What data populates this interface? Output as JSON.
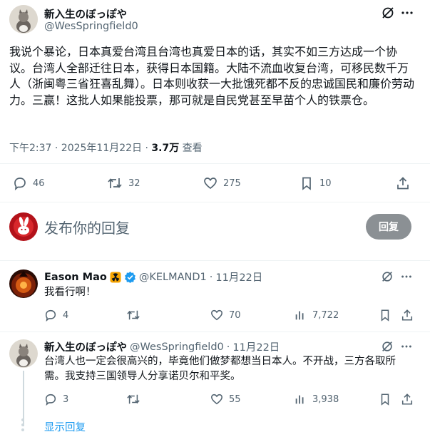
{
  "main_tweet": {
    "author_name": "新入生のぼっぽや",
    "handle": "@WesSpringfield0",
    "text": "我说个暴论，日本真爱台湾且台湾也真爱日本的话，其实不如三方达成一个协议。台湾人全部迁往日本，获得日本国籍。大陆不流血收复台湾，可移民数千万人（浙闽粤三省狂喜乱舞）。日本则收获一大批饿死都不反的忠诚国民和廉价劳动力。三赢！这批人如果能投票，那可就是自民党甚至早苗个人的铁票仓。",
    "timestamp": "下午2:37 · 2025年11月22日 · ",
    "views_value": "3.7万",
    "views_label": " 查看",
    "replies": "46",
    "retweets": "32",
    "likes": "275",
    "bookmarks": "10"
  },
  "compose": {
    "placeholder": "发布你的回复",
    "button_label": "回复"
  },
  "replies": [
    {
      "author_name": "Eason Mao",
      "handle": "@KELMAND1",
      "date": "11月22日",
      "text": "我看行啊！",
      "replies": "4",
      "retweets": "",
      "likes": "70",
      "views": "7,722",
      "verified": true
    },
    {
      "author_name": "新入生のぼっぽや",
      "handle": "@WesSpringfield0",
      "date": "11月22日",
      "text": "台湾人也一定会很高兴的，毕竟他们做梦都想当日本人。不开战，三方各取所需。我支持三国领导人分享诺贝尔和平奖。",
      "replies": "3",
      "retweets": "",
      "likes": "55",
      "views": "3,938"
    }
  ],
  "show_replies": "显示回复",
  "separator": " · ",
  "colors": {
    "accent": "#1d9bf0",
    "muted": "#536471",
    "verified": "#1d9bf0",
    "reply_button": "#8b9094"
  }
}
